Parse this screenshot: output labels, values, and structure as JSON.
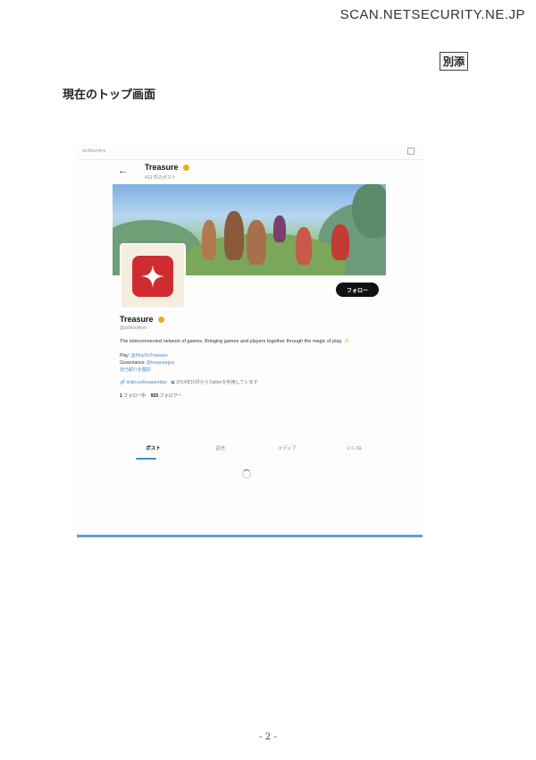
{
  "page": {
    "watermark": "SCAN.NETSECURITY.NE.JP",
    "attachment_label": "別添",
    "heading": "現在のトップ画面",
    "page_number": "- 2 -"
  },
  "screenshot": {
    "address": "/achiovnkyo",
    "header": {
      "name": "Treasure",
      "post_count": "413 件のポスト"
    },
    "follow_button": "フォロー",
    "profile": {
      "name": "Treasure",
      "handle": "@achiovnkyo",
      "bio": "The interconnected network of games. Bringing games and players together through the magic of play. ✨",
      "play_label": "Play:",
      "play_link": "@PlayOnTreasure",
      "governance_label": "Governance:",
      "governance_link": "@treasuregov",
      "translate_link": "自己紹介を翻訳",
      "website": "linktr.ee/treasuredao",
      "joined": "2014年10月からTwitterを利用しています",
      "following_count": "1",
      "following_label": "フォロー中",
      "followers_count": "933",
      "followers_label": "フォロワー"
    },
    "tabs": [
      "ポスト",
      "返信",
      "メディア",
      "いいね"
    ]
  },
  "colors": {
    "accent": "#3a8fd9",
    "avatar_red": "#cf2c32",
    "verified": "#e2b60f",
    "bottom_rule": "#5fa0cc"
  },
  "icons": [
    "back-arrow-icon",
    "verified-badge-icon",
    "sparkle-icon",
    "link-icon",
    "calendar-icon",
    "loading-spinner-icon"
  ]
}
